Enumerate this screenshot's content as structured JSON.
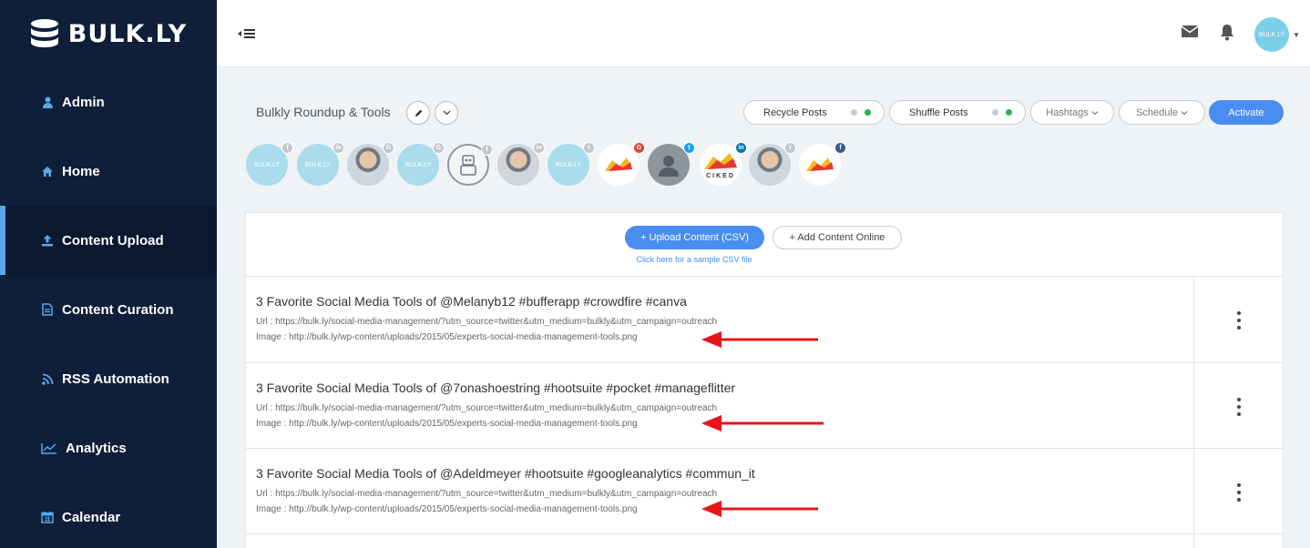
{
  "brand": {
    "name": "BULK.LY"
  },
  "sidebar": {
    "items": [
      {
        "label": "Admin",
        "icon": "user-icon"
      },
      {
        "label": "Home",
        "icon": "home-icon"
      },
      {
        "label": "Content Upload",
        "icon": "upload-icon",
        "active": true
      },
      {
        "label": "Content Curation",
        "icon": "document-icon"
      },
      {
        "label": "RSS Automation",
        "icon": "rss-icon"
      },
      {
        "label": "Analytics",
        "icon": "chart-line-icon"
      },
      {
        "label": "Calendar",
        "icon": "calendar-icon"
      }
    ]
  },
  "topbar": {
    "avatar_text": "BULK.LY"
  },
  "group": {
    "title": "Bulkly Roundup & Tools",
    "recycle_label": "Recycle Posts",
    "shuffle_label": "Shuffle Posts",
    "hashtags_label": "Hashtags",
    "schedule_label": "Schedule",
    "activate_label": "Activate"
  },
  "profiles": [
    {
      "type": "bulkly",
      "network": "facebook",
      "text": "BULK.LY"
    },
    {
      "type": "bulkly",
      "network": "linkedin",
      "text": "BULK.LY"
    },
    {
      "type": "person",
      "network": "google"
    },
    {
      "type": "bulkly",
      "network": "google",
      "text": "BULK.LY"
    },
    {
      "type": "logo",
      "network": "facebook"
    },
    {
      "type": "person",
      "network": "linkedin"
    },
    {
      "type": "bulkly",
      "network": "twitter",
      "text": "BULK.LY"
    },
    {
      "type": "fire",
      "network": "google"
    },
    {
      "type": "gray",
      "network": "twitter"
    },
    {
      "type": "fire",
      "network": "linkedin",
      "caption": "CIKED"
    },
    {
      "type": "person",
      "network": "twitter"
    },
    {
      "type": "fire",
      "network": "facebook"
    }
  ],
  "content": {
    "upload_label": "+ Upload Content (CSV)",
    "add_label": "+ Add Content Online",
    "sample_link": "Click here for a sample CSV file",
    "rows": [
      {
        "title": "3 Favorite Social Media Tools of @Melanyb12 #bufferapp #crowdfire #canva",
        "url": "Url : https://bulk.ly/social-media-management/?utm_source=twitter&utm_medium=bulkly&utm_campaign=outreach",
        "image": "Image : http://bulk.ly/wp-content/uploads/2015/05/experts-social-media-management-tools.png"
      },
      {
        "title": "3 Favorite Social Media Tools of @7onashoestring #hootsuite #pocket #manageflitter",
        "url": "Url : https://bulk.ly/social-media-management/?utm_source=twitter&utm_medium=bulkly&utm_campaign=outreach",
        "image": "Image : http://bulk.ly/wp-content/uploads/2015/05/experts-social-media-management-tools.png"
      },
      {
        "title": "3 Favorite Social Media Tools of @Adeldmeyer #hootsuite #googleanalytics #commun_it",
        "url": "Url : https://bulk.ly/social-media-management/?utm_source=twitter&utm_medium=bulkly&utm_campaign=outreach",
        "image": "Image : http://bulk.ly/wp-content/uploads/2015/05/experts-social-media-management-tools.png"
      }
    ]
  },
  "colors": {
    "sidebar": "#0f1f3a",
    "accent": "#4a8df0",
    "arrow": "#e8141b",
    "toggle_on": "#2db04b"
  }
}
